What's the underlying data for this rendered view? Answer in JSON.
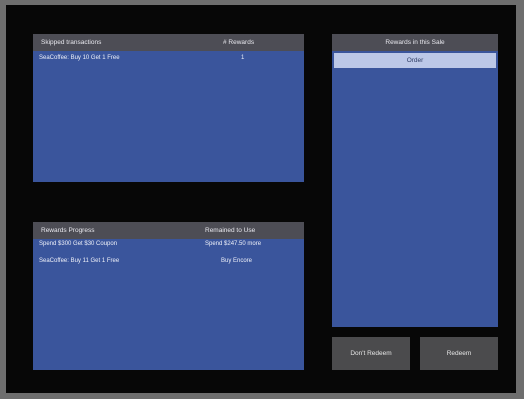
{
  "skipped_transactions": {
    "header_name": "Skipped transactions",
    "header_count": "# Rewards",
    "rows": [
      {
        "name": "SeaCoffee: Buy 10 Get 1 Free",
        "count": "1"
      }
    ]
  },
  "rewards_progress": {
    "header_name": "Rewards Progress",
    "header_status": "Remained to Use",
    "rows": [
      {
        "name": "Spend $300 Get $30 Coupon",
        "status": "Spend $247.50 more"
      },
      {
        "name": "SeaCoffee: Buy 11 Get 1 Free",
        "status": "Buy Encore"
      }
    ]
  },
  "rewards_in_sale": {
    "header": "Rewards in this Sale",
    "selected_item": "Order"
  },
  "buttons": {
    "left": "Don't Redeem",
    "right": "Redeem"
  },
  "colors": {
    "panel_blue": "#3a559c",
    "header_gray": "#4d4d55",
    "selected_row": "#bcc8e8",
    "background": "#070707"
  }
}
